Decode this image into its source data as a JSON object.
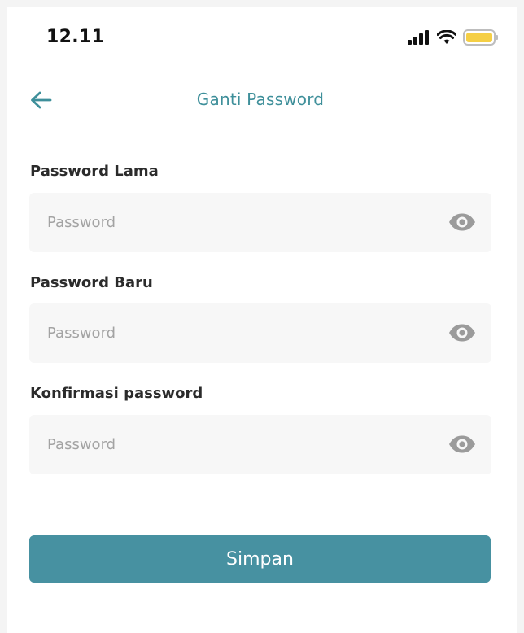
{
  "status_bar": {
    "time": "12.11",
    "icons": [
      "signal-icon",
      "wifi-icon",
      "battery-icon"
    ],
    "battery_color": "#f5cf45"
  },
  "header": {
    "back_icon": "arrow-left-icon",
    "title": "Ganti Password"
  },
  "form": {
    "fields": [
      {
        "label": "Password Lama",
        "placeholder": "Password",
        "value": "",
        "toggle_icon": "eye-icon"
      },
      {
        "label": "Password Baru",
        "placeholder": "Password",
        "value": "",
        "toggle_icon": "eye-icon"
      },
      {
        "label": "Konfirmasi password",
        "placeholder": "Password",
        "value": "",
        "toggle_icon": "eye-icon"
      }
    ]
  },
  "actions": {
    "save_label": "Simpan"
  },
  "colors": {
    "accent": "#3e8f9a",
    "button": "#4791a1",
    "field_bg": "#f7f7f7",
    "placeholder": "#a3a3a3",
    "icon_gray": "#9b9b9b"
  }
}
